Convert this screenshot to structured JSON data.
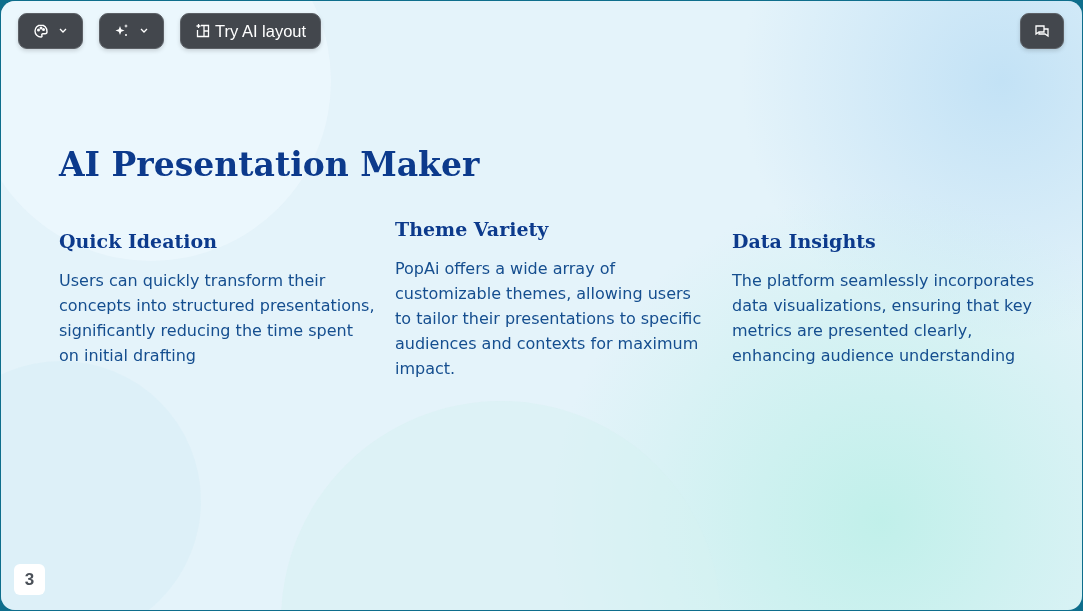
{
  "toolbar": {
    "buttons": [
      {
        "kind": "palette"
      },
      {
        "kind": "sparkle"
      },
      {
        "kind": "layout",
        "label": "Try AI layout"
      }
    ],
    "comment_button": {
      "kind": "comments"
    }
  },
  "slide": {
    "title": "AI Presentation Maker",
    "columns": [
      {
        "heading": "Quick Ideation",
        "body": "Users can quickly transform their concepts into structured presentations, significantly reducing the time spent on initial drafting"
      },
      {
        "heading": "Theme Variety",
        "body": "PopAi offers a wide array of customizable themes, allowing users to tailor their presentations to specific audiences and contexts for maximum impact."
      },
      {
        "heading": "Data Insights",
        "body": "The platform seamlessly incorporates data visualizations, ensuring that key metrics are presented clearly, enhancing audience understanding"
      }
    ]
  },
  "page_number": "3"
}
